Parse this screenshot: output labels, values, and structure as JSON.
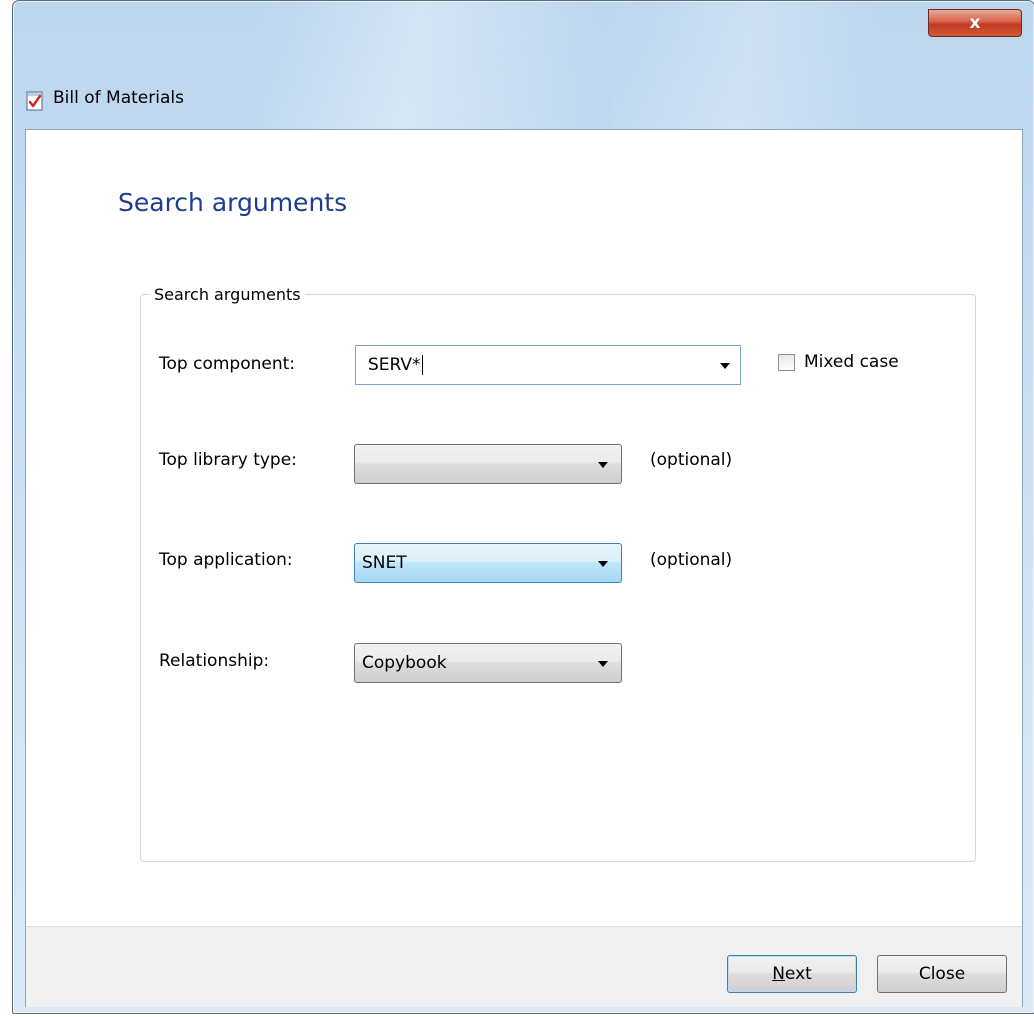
{
  "window": {
    "title": "Bill of Materials",
    "close_glyph": "x"
  },
  "page": {
    "heading": "Search arguments"
  },
  "group": {
    "legend": "Search arguments"
  },
  "fields": {
    "top_component": {
      "label": "Top component:",
      "value": "SERV*"
    },
    "mixed_case": {
      "label": "Mixed case",
      "checked": false
    },
    "top_library_type": {
      "label": "Top library type:",
      "value": "",
      "hint": "(optional)"
    },
    "top_application": {
      "label": "Top application:",
      "value": "SNET",
      "hint": "(optional)"
    },
    "relationship": {
      "label": "Relationship:",
      "value": "Copybook"
    }
  },
  "buttons": {
    "next": "Next",
    "close": "Close"
  },
  "icons": {
    "title_icon": "checklist-icon",
    "close_icon": "close-icon",
    "dropdown_icon": "chevron-down-icon"
  },
  "colors": {
    "heading": "#1e3d8f",
    "close_button": "#c23a1f",
    "focus_border": "#3c7fb1"
  }
}
